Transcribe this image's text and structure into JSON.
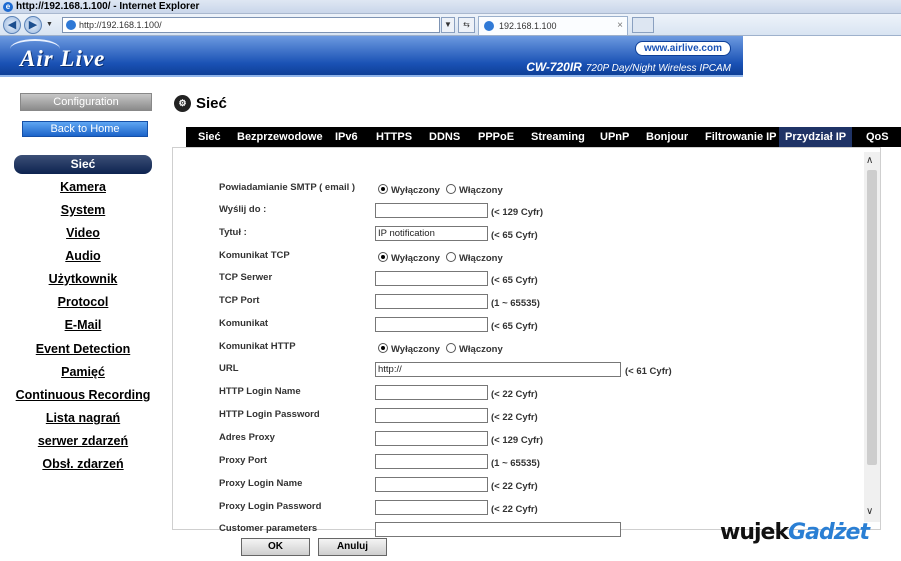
{
  "browser": {
    "title": "http://192.168.1.100/ - Internet Explorer",
    "url": "http://192.168.1.100/",
    "tab_label": "192.168.1.100",
    "tab_close": "×"
  },
  "header": {
    "logo": "Air Live",
    "site": "www.airlive.com",
    "model": "CW-720IR",
    "model_desc": "720P Day/Night Wireless IPCAM"
  },
  "sidebar": {
    "configuration": "Configuration",
    "back_home": "Back to Home",
    "active_item": "Sieć",
    "items": [
      "Kamera",
      "System",
      "Video",
      "Audio",
      "Użytkownik",
      "Protocol",
      "E-Mail",
      "Event Detection",
      "Pamięć",
      "Continuous Recording",
      "Lista nagrań",
      "serwer zdarzeń",
      "Obsł. zdarzeń"
    ]
  },
  "main": {
    "heading": "Sieć",
    "tabs": [
      "Sieć",
      "Bezprzewodowe",
      "IPv6",
      "HTTPS",
      "DDNS",
      "PPPoE",
      "Streaming",
      "UPnP",
      "Bonjour",
      "Filtrowanie IP",
      "Przydział IP",
      "QoS"
    ],
    "active_tab": "Przydział IP",
    "radio_off": "Wyłączony",
    "radio_on": "Włączony",
    "fields": [
      {
        "label": "Powiadamianie SMTP ( email )",
        "type": "radio",
        "selected": "off"
      },
      {
        "label": "Wyślij do :",
        "type": "text",
        "value": "",
        "hint": "(< 129 Cyfr)"
      },
      {
        "label": "Tytuł :",
        "type": "text",
        "value": "IP notification",
        "hint": "(< 65 Cyfr)"
      },
      {
        "label": "Komunikat TCP",
        "type": "radio",
        "selected": "off"
      },
      {
        "label": "TCP Serwer",
        "type": "text",
        "value": "",
        "hint": "(< 65 Cyfr)"
      },
      {
        "label": "TCP Port",
        "type": "text",
        "value": "",
        "hint": "(1 ~ 65535)"
      },
      {
        "label": "Komunikat",
        "type": "text",
        "value": "",
        "hint": "(< 65 Cyfr)"
      },
      {
        "label": "Komunikat HTTP",
        "type": "radio",
        "selected": "off"
      },
      {
        "label": "URL",
        "type": "text-wide",
        "value": "http://",
        "hint": "(< 61 Cyfr)"
      },
      {
        "label": "HTTP Login Name",
        "type": "text",
        "value": "",
        "hint": "(< 22 Cyfr)"
      },
      {
        "label": "HTTP Login Password",
        "type": "text",
        "value": "",
        "hint": "(< 22 Cyfr)"
      },
      {
        "label": "Adres Proxy",
        "type": "text",
        "value": "",
        "hint": "(< 129 Cyfr)"
      },
      {
        "label": "Proxy Port",
        "type": "text",
        "value": "",
        "hint": "(1 ~ 65535)"
      },
      {
        "label": "Proxy Login Name",
        "type": "text",
        "value": "",
        "hint": "(< 22 Cyfr)"
      },
      {
        "label": "Proxy Login Password",
        "type": "text",
        "value": "",
        "hint": "(< 22 Cyfr)"
      },
      {
        "label": "Customer parameters",
        "type": "text-wide",
        "value": "",
        "hint": ""
      }
    ],
    "ok": "OK",
    "cancel": "Anuluj"
  },
  "watermark": {
    "part1": "wujek",
    "part2": "Gadżet"
  }
}
